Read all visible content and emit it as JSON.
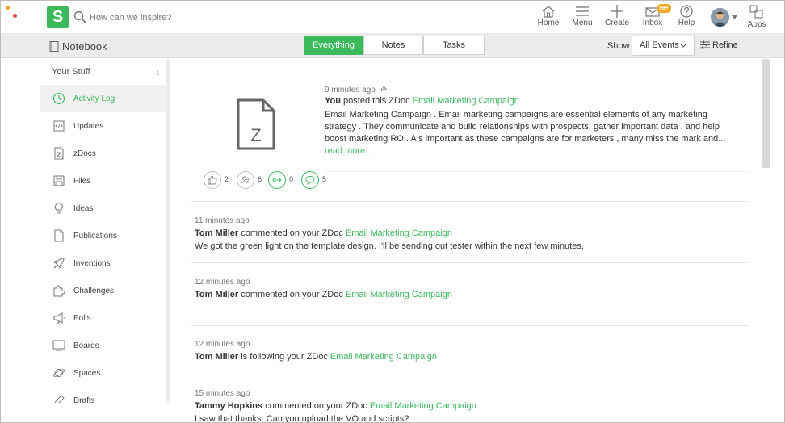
{
  "app": {
    "logo_letter": "S",
    "search_placeholder": "How can we inspire?"
  },
  "nav": {
    "home": "Home",
    "menu": "Menu",
    "create": "Create",
    "inbox": "Inbox",
    "inbox_badge": "99+",
    "help": "Help",
    "apps": "Apps"
  },
  "subheader": {
    "title": "Notebook",
    "tabs": [
      "Everything",
      "Notes",
      "Tasks"
    ],
    "active_tab": "Everything",
    "show_label": "Show",
    "events_filter": "All Events",
    "refine_label": "Refine"
  },
  "sidebar": {
    "heading": "Your Stuff",
    "items": [
      {
        "label": "Activity Log",
        "icon": "clock-icon",
        "active": true
      },
      {
        "label": "Updates",
        "icon": "updates-icon"
      },
      {
        "label": "zDocs",
        "icon": "zdoc-icon"
      },
      {
        "label": "Files",
        "icon": "files-icon"
      },
      {
        "label": "Ideas",
        "icon": "lightbulb-icon"
      },
      {
        "label": "Publications",
        "icon": "publication-icon"
      },
      {
        "label": "Inventions",
        "icon": "rocket-icon"
      },
      {
        "label": "Challenges",
        "icon": "puzzle-icon"
      },
      {
        "label": "Polls",
        "icon": "megaphone-icon"
      },
      {
        "label": "Boards",
        "icon": "board-icon"
      },
      {
        "label": "Spaces",
        "icon": "planet-icon"
      },
      {
        "label": "Drafts",
        "icon": "pencil-icon"
      }
    ]
  },
  "feed": {
    "post": {
      "time": "9 minutes ago",
      "actor": "You",
      "action": "posted this ZDoc",
      "doc": "Email Marketing Campaign",
      "doc_letter": "Z",
      "body": "Email Marketing Campaign . Email marketing campaigns are essential elements of any marketing strategy . They communicate and build relationships with prospects, gather important data , and help boost marketing ROI. A s important as these campaigns are for marketers , many miss the mark and...",
      "read_more": "read more...",
      "reactions": {
        "likes": "2",
        "followers": "6",
        "shares": "0",
        "comments": "5"
      }
    },
    "entries": [
      {
        "time": "11 minutes ago",
        "actor": "Tom Miller",
        "action": "commented on your ZDoc",
        "doc": "Email Marketing Campaign",
        "message": "We got the green light on the template design.  I'll be sending out tester within the next few minutes."
      },
      {
        "time": "12 minutes ago",
        "actor": "Tom Miller",
        "action": "commented on your ZDoc",
        "doc": "Email Marketing Campaign",
        "message": ""
      },
      {
        "time": "12 minutes ago",
        "actor": "Tom Miller",
        "action": "is following your ZDoc",
        "doc": "Email Marketing Campaign",
        "message": ""
      },
      {
        "time": "15 minutes ago",
        "actor": "Tammy Hopkins",
        "action": "commented on your ZDoc",
        "doc": "Email Marketing Campaign",
        "message": "I saw that thanks.  Can you upload the VO and scripts?"
      }
    ]
  },
  "colors": {
    "accent": "#3cb95c",
    "badge": "#f6a623",
    "logo_dot_orange": "#f6a623",
    "logo_dot_red": "#e0463c"
  }
}
